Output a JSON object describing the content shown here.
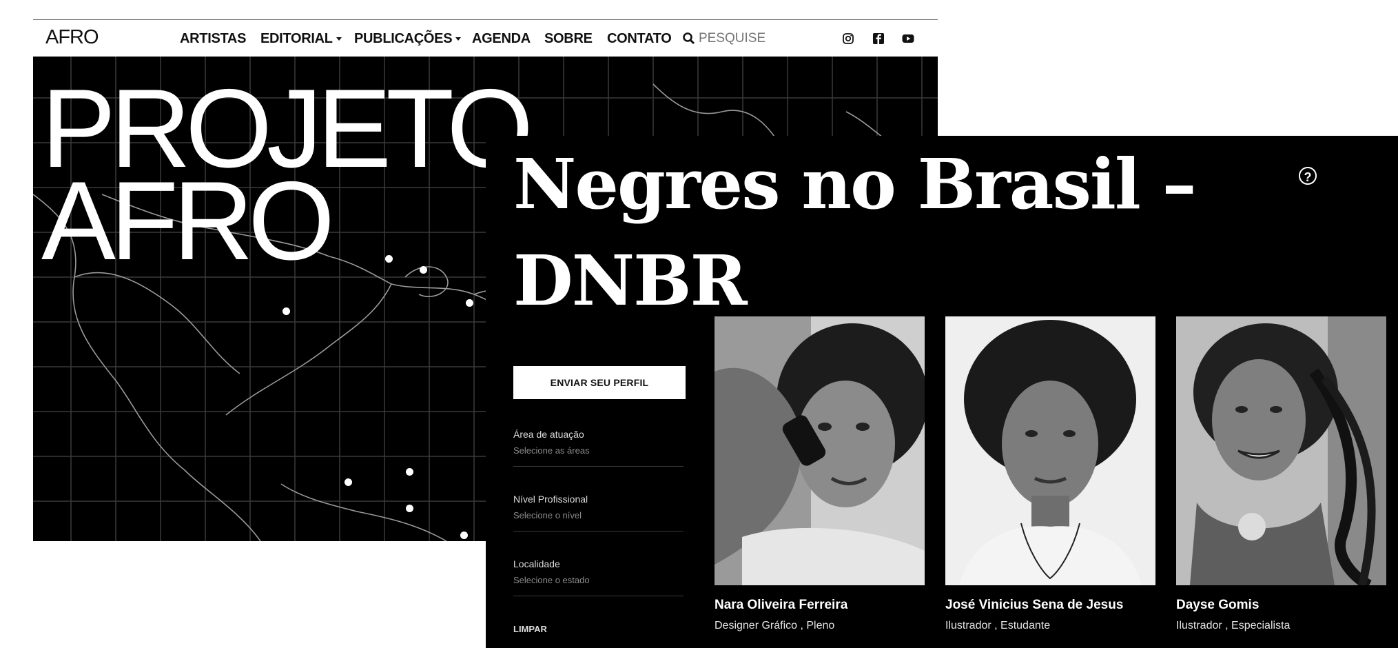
{
  "back_window": {
    "logo": "AFRO",
    "nav": [
      {
        "label": "ARTISTAS",
        "dropdown": false
      },
      {
        "label": "EDITORIAL",
        "dropdown": true
      },
      {
        "label": "PUBLICAÇÕES",
        "dropdown": true
      },
      {
        "label": "AGENDA",
        "dropdown": false
      },
      {
        "label": "SOBRE",
        "dropdown": false
      },
      {
        "label": "CONTATO",
        "dropdown": false
      }
    ],
    "search": {
      "placeholder": "PESQUISE"
    },
    "social": [
      "instagram-icon",
      "facebook-icon",
      "youtube-icon"
    ],
    "hero": {
      "title_line1": "PROJETO",
      "title_line2": "AFRO"
    }
  },
  "front_window": {
    "title": "Negres no Brasil – DNBR",
    "send_button": "ENVIAR SEU PERFIL",
    "filters": [
      {
        "label": "Área de atuação",
        "placeholder": "Selecione as áreas"
      },
      {
        "label": "Nível Profissional",
        "placeholder": "Selecione o nível"
      },
      {
        "label": "Localidade",
        "placeholder": "Selecione o estado"
      }
    ],
    "clear_label": "LIMPAR",
    "profiles": [
      {
        "name": "Nara Oliveira Ferreira",
        "role": "Designer Gráfico , Pleno"
      },
      {
        "name": "José Vinicius Sena de Jesus",
        "role": "Ilustrador , Estudante"
      },
      {
        "name": "Dayse Gomis",
        "role": "Ilustrador , Especialista"
      }
    ],
    "colors": {
      "background": "#000000",
      "text": "#ffffff"
    }
  }
}
